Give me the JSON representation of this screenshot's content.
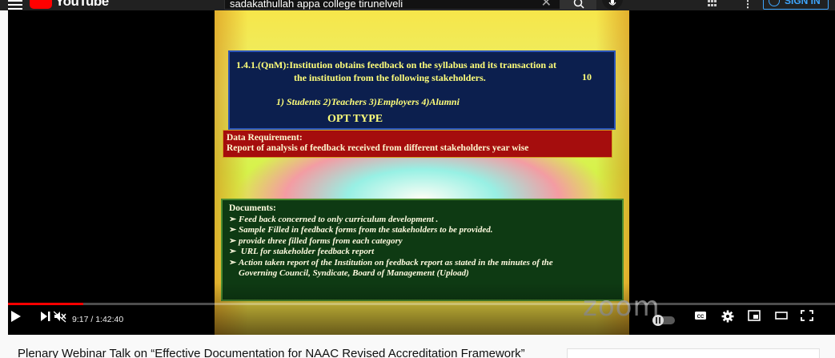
{
  "header": {
    "logo_text": "YouTube",
    "search_value": "sadakathullah appa college tirunelveli",
    "clear_glyph": "✕",
    "kebab_glyph": "⋮",
    "signin_label": "SIGN IN"
  },
  "slide": {
    "heading_line1": "1.4.1.(QnM):Institution obtains  feedback on the syllabus and its transaction at",
    "heading_line2": "the institution from the following  stakeholders.",
    "marks": "10",
    "stakeholders": "1) Students 2)Teachers 3)Employers 4)Alumni",
    "opt_type": "OPT TYPE",
    "data_req_title": "Data Requirement:",
    "data_req_text": "Report of analysis of feedback received from different stakeholders year wise",
    "documents_title": "Documents:",
    "documents": [
      "Feed back concerned to only curriculum development .",
      "Sample Filled in feedback forms from the stakeholders to be provided.",
      "provide three filled forms from each category",
      " URL for stakeholder feedback report",
      "Action taken report of the Institution on feedback report as stated in the minutes of the"
    ],
    "documents_continuation": "Governing Council, Syndicate, Board of Management (Upload)"
  },
  "player": {
    "watermark": "zoom",
    "time_display": "9:17 / 1:42:40",
    "progress_fraction": 0.0905
  },
  "video": {
    "title": "Plenary Webinar Talk on “Effective Documentation for NAAC Revised Accreditation Framework”"
  },
  "colors": {
    "brand_red": "#ff0000",
    "accent_blue": "#3ea6ff"
  }
}
